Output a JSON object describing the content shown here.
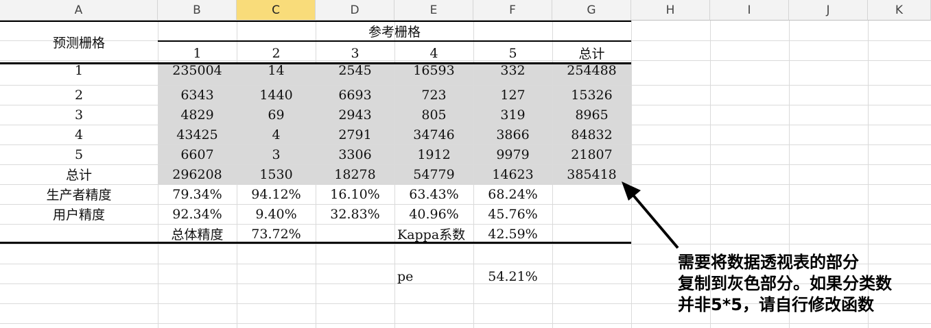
{
  "columns": [
    "A",
    "B",
    "C",
    "D",
    "E",
    "F",
    "G",
    "H",
    "I",
    "J",
    "K"
  ],
  "selected_column": "C",
  "table": {
    "pred_label": "预测栅格",
    "ref_label": "参考栅格",
    "ref_headers": [
      "1",
      "2",
      "3",
      "4",
      "5",
      "总计"
    ],
    "row_labels": [
      "1",
      "2",
      "3",
      "4",
      "5",
      "总计"
    ],
    "matrix": [
      [
        "235004",
        "14",
        "2545",
        "16593",
        "332",
        "254488"
      ],
      [
        "6343",
        "1440",
        "6693",
        "723",
        "127",
        "15326"
      ],
      [
        "4829",
        "69",
        "2943",
        "805",
        "319",
        "8965"
      ],
      [
        "43425",
        "4",
        "2791",
        "34746",
        "3866",
        "84832"
      ],
      [
        "6607",
        "3",
        "3306",
        "1912",
        "9979",
        "21807"
      ],
      [
        "296208",
        "1530",
        "18278",
        "54779",
        "14623",
        "385418"
      ]
    ],
    "producer_label": "生产者精度",
    "producer": [
      "79.34%",
      "94.12%",
      "16.10%",
      "63.43%",
      "68.24%"
    ],
    "user_label": "用户精度",
    "user": [
      "92.34%",
      "9.40%",
      "32.83%",
      "40.96%",
      "45.76%"
    ],
    "overall_label": "总体精度",
    "overall_value": "73.72%",
    "kappa_label": "Kappa系数",
    "kappa_value": "42.59%",
    "pe_label": "pe",
    "pe_value": "54.21%"
  },
  "note": {
    "line1": "需要将数据透视表的部分",
    "line2": "复制到灰色部分。如果分类数",
    "line3": "并非5*5，请自行修改函数"
  }
}
